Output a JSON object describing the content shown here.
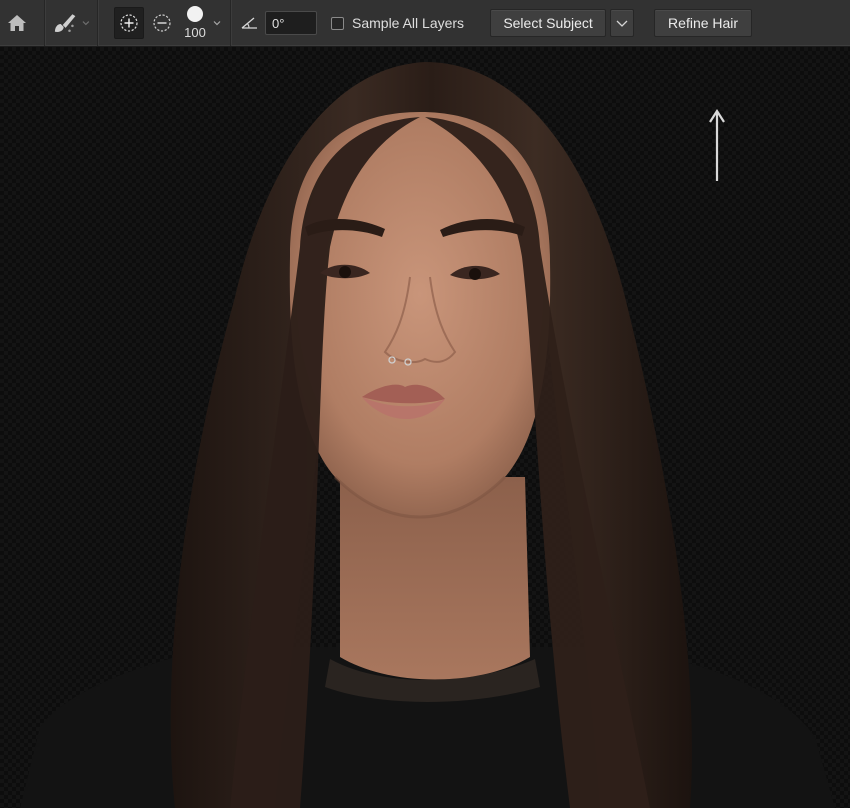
{
  "toolbar": {
    "tool_preset_icon": "quick-selection-brush-icon",
    "add_mode_icon": "add-to-selection-icon",
    "subtract_mode_icon": "subtract-from-selection-icon",
    "brush_size": "100",
    "angle_value": "0°",
    "sample_all_layers_label": "Sample All Layers",
    "sample_all_layers_checked": false,
    "select_subject_label": "Select Subject",
    "refine_hair_label": "Refine Hair"
  },
  "colors": {
    "toolbar_bg": "#323232",
    "canvas_bg": "#0d0d0d",
    "button_bg": "#3f3f3f"
  }
}
